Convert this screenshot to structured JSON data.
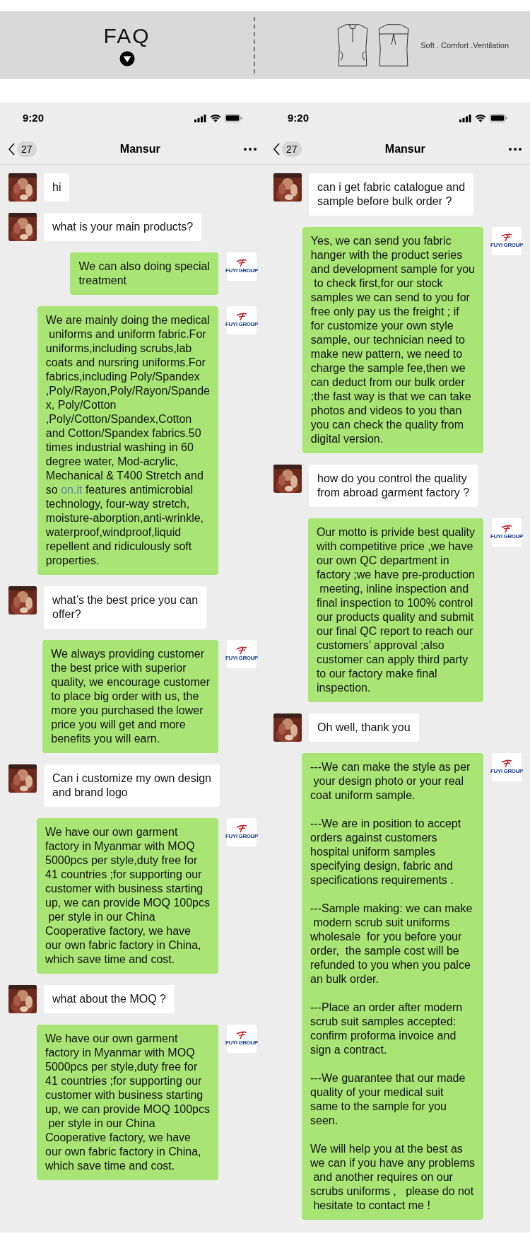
{
  "header": {
    "title": "FAQ",
    "tagline": "Soft . Comfort .Ventilation"
  },
  "screens": [
    {
      "time": "9:20",
      "back_count": "27",
      "contact": "Mansur",
      "messages": [
        {
          "kind": "received",
          "parts": [
            {
              "kind": "text",
              "text": "hi"
            }
          ]
        },
        {
          "kind": "received",
          "parts": [
            {
              "kind": "text",
              "text": "what is your main products?"
            }
          ]
        },
        {
          "kind": "sent",
          "avatar_label": "FUYI GROUP",
          "parts": [
            {
              "kind": "text",
              "text": "We can also doing special\ntreatment"
            }
          ]
        },
        {
          "kind": "sent",
          "avatar_label": "FUYI GROUP",
          "parts": [
            {
              "kind": "text",
              "text": "We are mainly doing the medical\n uniforms and uniform fabric.For\nuniforms,including scrubs,lab\ncoats and nursring uniforms.For\nfabrics,including Poly/Spandex\n,Poly/Rayon,Poly/Rayon/Spande\nx, Poly/Cotton\n,Poly/Cotton/Spandex,Cotton\nand Cotton/Spandex fabrics.50\ntimes industrial washing in 60\ndegree water, Mod-acrylic,\nMechanical & T400 Stretch and\nso "
            },
            {
              "kind": "link",
              "text": "on.it"
            },
            {
              "kind": "text",
              "text": " features antimicrobial\ntechnology, four-way stretch,\nmoisture-aborption,anti-wrinkle,\nwaterproof,windproof,liquid\nrepellent and ridiculously soft\nproperties."
            }
          ]
        },
        {
          "kind": "received",
          "parts": [
            {
              "kind": "text",
              "text": "what’s the best price you can\noffer?"
            }
          ]
        },
        {
          "kind": "sent",
          "avatar_label": "FUYI GROUP",
          "parts": [
            {
              "kind": "text",
              "text": "We always providing customer\nthe best price with superior\nquality, we encourage customer\nto place big order with us, the\nmore you purchased the lower\nprice you will get and more\nbenefits you will earn."
            }
          ]
        },
        {
          "kind": "received",
          "parts": [
            {
              "kind": "text",
              "text": "Can i customize my own design\nand brand logo"
            }
          ]
        },
        {
          "kind": "sent",
          "avatar_label": "FUYI GROUP",
          "parts": [
            {
              "kind": "text",
              "text": "We have our own garment\nfactory in Myanmar with MOQ\n5000pcs per style,duty free for\n41 countries ;for supporting our\ncustomer with business starting\nup, we can provide MOQ 100pcs\n per style in our China\nCooperative factory, we have\nour own fabric factory in China,\nwhich save time and cost."
            }
          ]
        },
        {
          "kind": "received",
          "parts": [
            {
              "kind": "text",
              "text": "what about the MOQ ?"
            }
          ]
        },
        {
          "kind": "sent",
          "avatar_label": "FUYI GROUP",
          "parts": [
            {
              "kind": "text",
              "text": "We have our own garment\nfactory in Myanmar with MOQ\n5000pcs per style,duty free for\n41 countries ;for supporting our\ncustomer with business starting\nup, we can provide MOQ 100pcs\n per style in our China\nCooperative factory, we have\nour own fabric factory in China,\nwhich save time and cost."
            }
          ]
        }
      ]
    },
    {
      "time": "9:20",
      "back_count": "27",
      "contact": "Mansur",
      "messages": [
        {
          "kind": "received",
          "parts": [
            {
              "kind": "text",
              "text": "can i get fabric catalogue and\nsample before bulk order ?"
            }
          ]
        },
        {
          "kind": "sent",
          "avatar_label": "FUYI GROUP",
          "parts": [
            {
              "kind": "text",
              "text": "Yes, we can send you fabric\nhanger with the product series\nand development sample for you\n to check first,for our stock\nsamples we can send to you for\nfree only pay us the freight ; if\nfor customize your own style\nsample, our technician need to\nmake new pattern, we need to\ncharge the sample fee,then we\ncan deduct from our bulk order\n;the fast way is that we can take\nphotos and videos to you than\nyou can check the quality from\ndigital version."
            }
          ]
        },
        {
          "kind": "received",
          "parts": [
            {
              "kind": "text",
              "text": "how do you control the quality\nfrom abroad garment factory ?"
            }
          ]
        },
        {
          "kind": "sent",
          "avatar_label": "FUYI GROUP",
          "parts": [
            {
              "kind": "text",
              "text": "Our motto is privide best quality\nwith competitive price ,we have\nour own QC department in\nfactory ;we have pre-production\n meeting, inline inspection and\nfinal inspection to 100% control\nour products quality and submit\nour final QC report to reach our\ncustomers’ approval ;also\ncustomer can apply third party\nto our factory make final\ninspection."
            }
          ]
        },
        {
          "kind": "received",
          "parts": [
            {
              "kind": "text",
              "text": "Oh well, thank you"
            }
          ]
        },
        {
          "kind": "sent",
          "avatar_label": "FUYI GROUP",
          "parts": [
            {
              "kind": "text",
              "text": "---We can make the style as per\n your design photo or your real\ncoat uniform sample.\n\n---We are in position to accept\norders against customers\nhospital uniform samples\nspecifying design, fabric and\nspecifications requirements .\n\n---Sample making: we can make\n modern scrub suit uniforms\nwholesale  for you before your\norder,  the sample cost will be\nrefunded to you when you palce\nan bulk order.\n\n---Place an order after modern\nscrub suit samples accepted:\nconfirm proforma invoice and\nsign a contract.\n\n---We guarantee that our made\nquality of your medical suit\nsame to the sample for you\nseen.\n\nWe will help you at the best as\nwe can if you have any problems\n and another requires on our\nscrubs uniforms ,   please do not\n hesitate to contact me !"
            }
          ]
        }
      ]
    }
  ]
}
